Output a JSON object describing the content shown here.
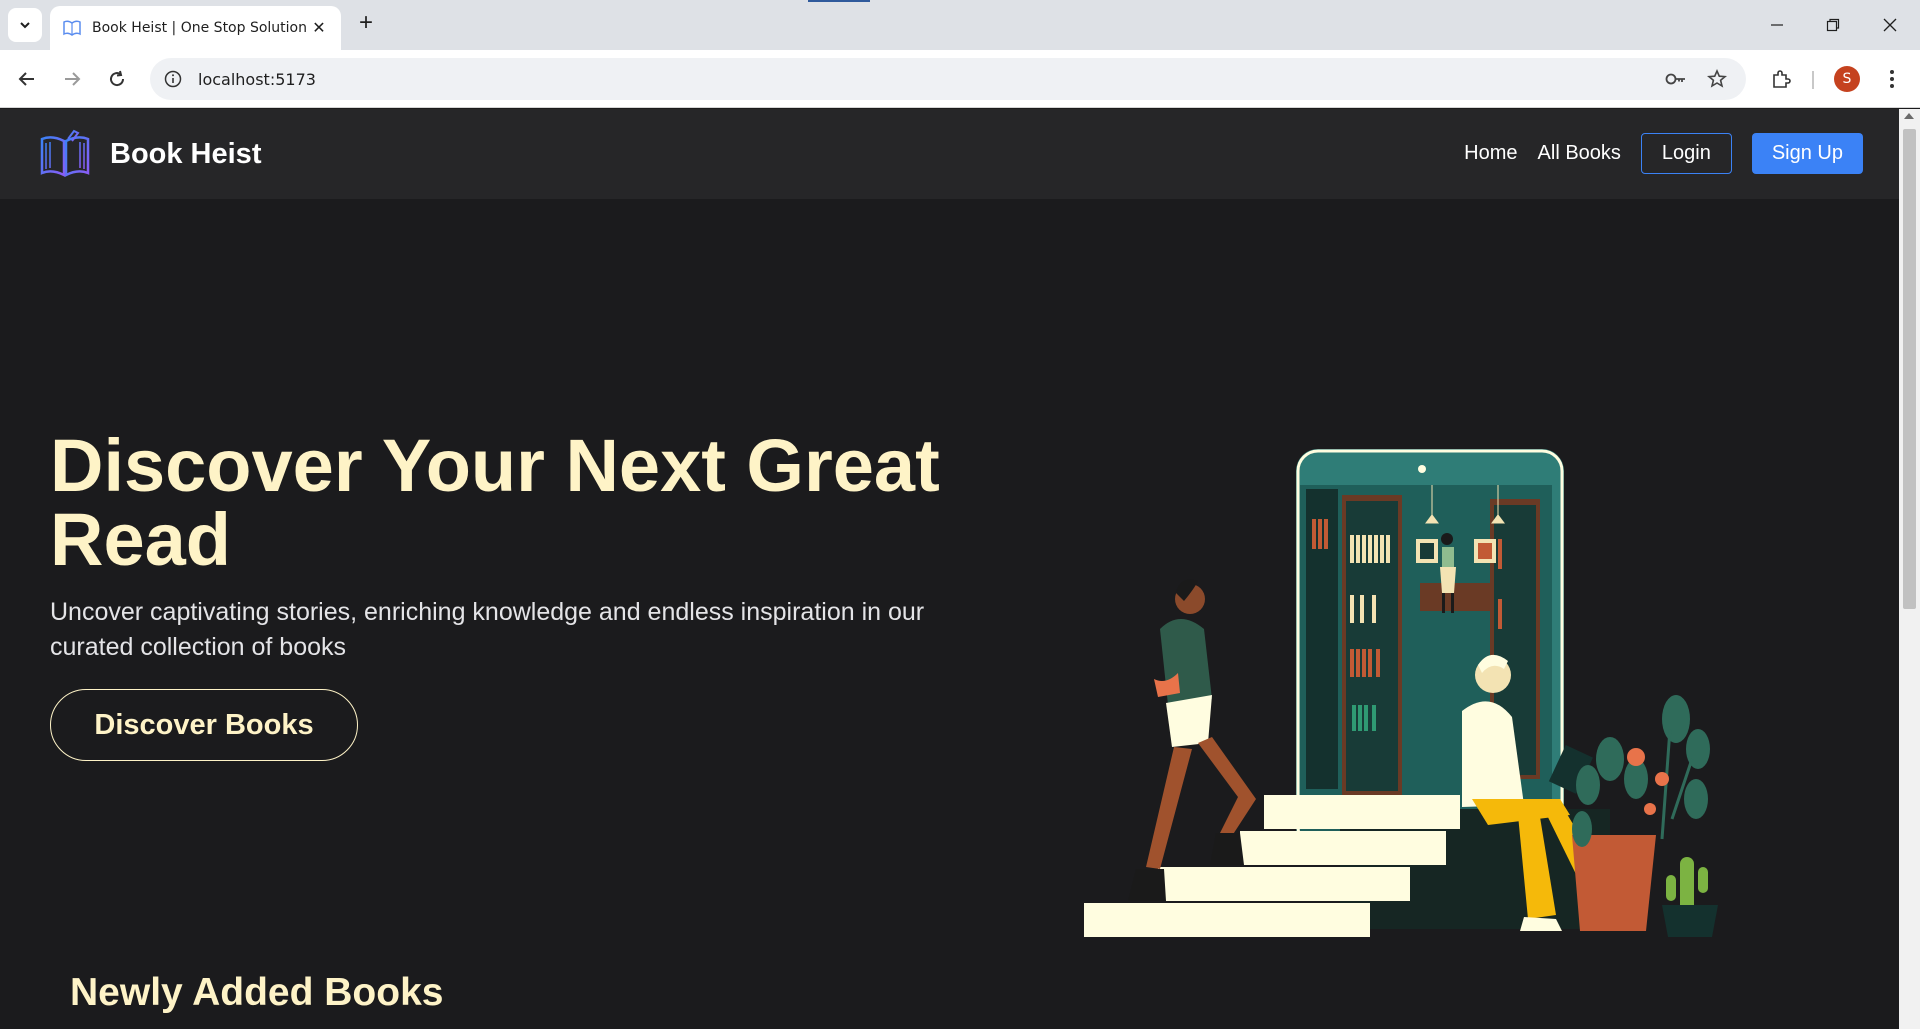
{
  "browser": {
    "tab_title": "Book Heist | One Stop Solution",
    "url": "localhost:5173",
    "profile_initial": "S"
  },
  "navbar": {
    "brand": "Book Heist",
    "links": [
      "Home",
      "All Books"
    ],
    "login": "Login",
    "signup": "Sign Up"
  },
  "hero": {
    "title": "Discover Your Next Great Read",
    "subtitle": "Uncover captivating stories, enriching knowledge and endless inspiration in our curated collection of books",
    "cta": "Discover Books"
  },
  "sections": {
    "newly_added": "Newly Added Books"
  },
  "colors": {
    "accent": "#3b82f6",
    "hero_text": "#fef3c7",
    "background": "#1b1b1d"
  }
}
